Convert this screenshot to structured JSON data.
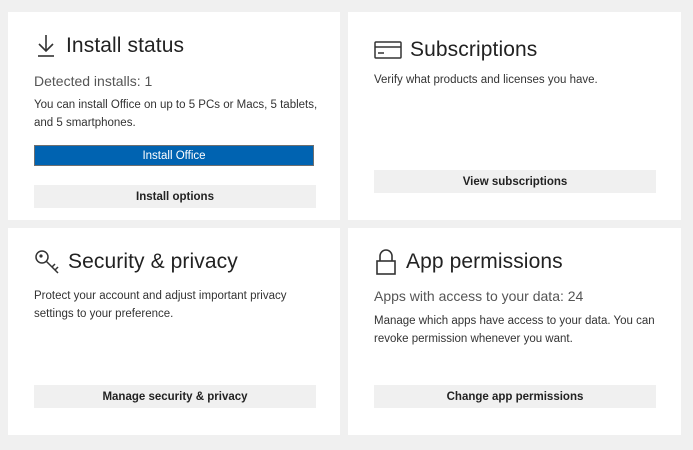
{
  "colors": {
    "primary": "#0063b1",
    "card_bg": "#ffffff",
    "page_bg": "#f0f0f0",
    "button_bg": "#f0f0f0"
  },
  "install_status": {
    "icon": "download-icon",
    "title": "Install status",
    "detected": "Detected installs: 1",
    "description": "You can install Office on up to 5 PCs or Macs, 5 tablets, and 5 smartphones.",
    "install_button": "Install Office",
    "options_button": "Install options"
  },
  "subscriptions": {
    "icon": "credit-card-icon",
    "title": "Subscriptions",
    "description": "Verify what products and licenses you have.",
    "button": "View subscriptions"
  },
  "security": {
    "icon": "key-icon",
    "title": "Security & privacy",
    "description": "Protect your account and adjust important privacy settings to your preference.",
    "button": "Manage security & privacy"
  },
  "app_permissions": {
    "icon": "lock-icon",
    "title": "App permissions",
    "access": "Apps with access to your data: 24",
    "description": "Manage which apps have access to your data. You can revoke permission whenever you want.",
    "button": "Change app permissions"
  }
}
